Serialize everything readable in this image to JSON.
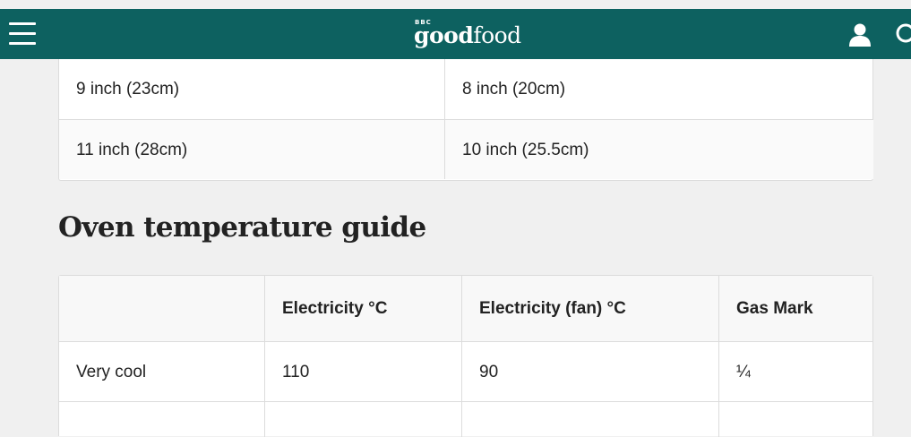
{
  "header": {
    "logo_bbc": "BBC",
    "logo_good": "good",
    "logo_food": "food"
  },
  "tin_table": {
    "rows": [
      [
        "9 inch (23cm)",
        "8 inch (20cm)"
      ],
      [
        "11 inch (28cm)",
        "10 inch (25.5cm)"
      ]
    ]
  },
  "oven_section": {
    "title": "Oven temperature guide",
    "columns": [
      "",
      "Electricity °C",
      "Electricity (fan) °C",
      "Gas Mark"
    ],
    "rows": [
      [
        "Very cool",
        "110",
        "90",
        "¼"
      ]
    ]
  },
  "colors": {
    "brand": "#0d6160",
    "background": "#f0f0f0",
    "border": "#dcdcdc"
  },
  "icons": {
    "menu": "hamburger-menu-icon",
    "user": "user-icon",
    "search": "search-icon"
  }
}
